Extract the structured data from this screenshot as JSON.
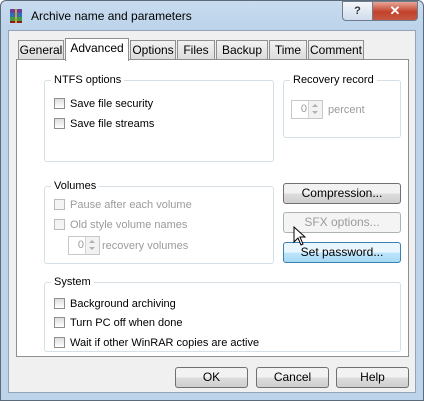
{
  "window": {
    "title": "Archive name and parameters",
    "help_label": "?",
    "close_label": "✕"
  },
  "tabs": [
    "General",
    "Advanced",
    "Options",
    "Files",
    "Backup",
    "Time",
    "Comment"
  ],
  "ntfs": {
    "title": "NTFS options",
    "save_security": "Save file security",
    "save_streams": "Save file streams"
  },
  "recovery": {
    "title": "Recovery record",
    "value": "0",
    "unit": "percent"
  },
  "volumes": {
    "title": "Volumes",
    "pause": "Pause after each volume",
    "old_style": "Old style volume names",
    "recovery_value": "0",
    "recovery_label": "recovery volumes"
  },
  "buttons": {
    "compression": "Compression...",
    "sfx": "SFX options...",
    "password": "Set password..."
  },
  "system": {
    "title": "System",
    "background": "Background archiving",
    "turn_off": "Turn PC off when done",
    "wait": "Wait if other WinRAR copies are active"
  },
  "footer": {
    "ok": "OK",
    "cancel": "Cancel",
    "help": "Help"
  },
  "icons": {
    "app": "winrar-icon",
    "cursor": "mouse-cursor-icon"
  }
}
